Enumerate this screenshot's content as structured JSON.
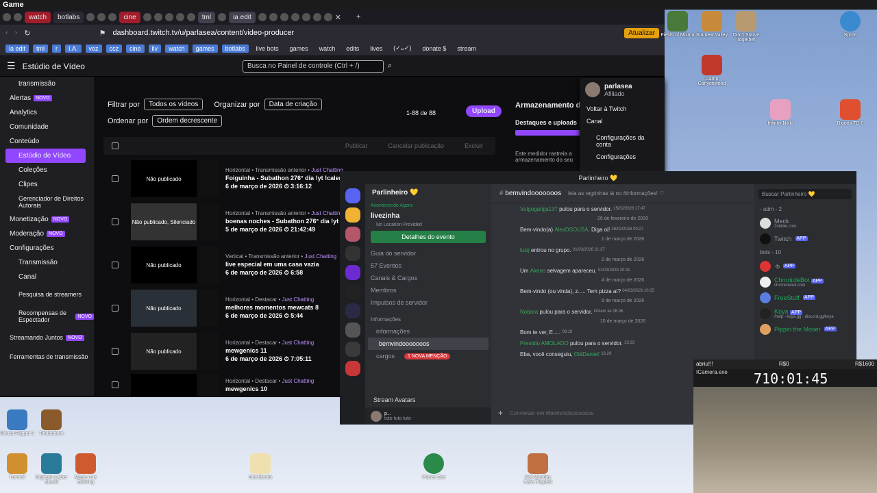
{
  "game_title": "Game",
  "browser": {
    "tabs": [
      "watch",
      "botlabs",
      "cine",
      "tml",
      "ia edit"
    ],
    "url": "dashboard.twitch.tv/u/parlasea/content/video-producer",
    "update_label": "Atualizar",
    "bookmarks": [
      "ia edit",
      "tml",
      "r",
      "I.A.",
      "voz",
      "ccz",
      "cine",
      "liv",
      "watch",
      "games",
      "botlabs",
      "live bots",
      "games",
      "watch",
      "edits",
      "lives",
      "(✓ᴗ✓)",
      "donate $",
      "stream"
    ]
  },
  "twitch": {
    "studio_title": "Estúdio de Vídeo",
    "search_placeholder": "Busca no Painel de controle (Ctrl + /)",
    "sidebar": [
      "transmissão",
      "Alertas",
      "Analytics",
      "Comunidade",
      "Conteúdo",
      "Estúdio de Vídeo",
      "Coleções",
      "Clipes",
      "Gerenciador de Direitos Autorais",
      "Monetização",
      "Moderação",
      "Configurações",
      "Transmissão",
      "Canal",
      "Pesquisa de streamers",
      "Recompensas de Espectador",
      "Streamando Juntos",
      "Ferramentas de transmissão"
    ],
    "new_badge": "NOVO",
    "filter_label": "Filtrar por",
    "filter_value": "Todos os vídeos",
    "organize_label": "Organizar por",
    "organize_value": "Data de criação",
    "order_label": "Ordenar por",
    "order_value": "Ordem decrescente",
    "count": "1-88 de 88",
    "upload": "Upload",
    "actions": [
      "Publicar",
      "Cancelar publicação",
      "Excluir"
    ],
    "storage_title": "Armazenamento de",
    "storage_sub": "Destaques e uploads",
    "storage_text": "Este medidor rastreia a armazenamento do seu",
    "rows": [
      {
        "meta": "Horizontal • Transmissão anterior •",
        "cat": "Just Chatting",
        "title": "Foiguinha - Subathon 276° dia !yt !calend Chatting\"",
        "date": "6 de março de 2026",
        "dur": "3:16:12",
        "status": "Não publicado"
      },
      {
        "meta": "Horizontal • Transmissão anterior •",
        "cat": "Just Chatting",
        "title": "boenas noches - Subathon 276° dia !yt !calend Chatting\"",
        "date": "5 de março de 2026",
        "dur": "21:42:49",
        "status": "Não publicado, Silenciado"
      },
      {
        "meta": "Vertical • Transmissão anterior •",
        "cat": "Just Chatting",
        "title": "live especial em uma casa vazia",
        "date": "6 de março de 2026",
        "dur": "6:58",
        "status": "Não publicado"
      },
      {
        "meta": "Horizontal • Destacar •",
        "cat": "Just Chatting",
        "title": "melhores momentos mewcats 8",
        "date": "6 de março de 2026",
        "dur": "5:44",
        "status": "Não publicado"
      },
      {
        "meta": "Horizontal • Destacar •",
        "cat": "Just Chatting",
        "title": "mewgenics 11",
        "date": "6 de março de 2026",
        "dur": "7:05:11",
        "status": "Não publicado"
      },
      {
        "meta": "Horizontal • Destacar •",
        "cat": "Just Chatting",
        "title": "mewgenics 10",
        "date": "",
        "dur": "",
        "status": ""
      }
    ],
    "dropdown": {
      "user": "parlasea",
      "role": "Afiliado",
      "items": [
        "Voltar à Twitch",
        "Canal",
        "Configurações da conta",
        "Configurações"
      ]
    }
  },
  "discord": {
    "title": "Parlinheiro 💛",
    "server": "Parlinheiro 💛",
    "event_now": "Acontecendo Agora",
    "event_name": "livezinha",
    "event_loc": "No Location Provided",
    "event_btn": "Detalhes do evento",
    "channels": [
      "Guia do servidor",
      "57 Eventos",
      "Canais & Cargos",
      "Membros",
      "Impulsos de servidor"
    ],
    "category": "Informações",
    "text_channels": [
      "informações",
      "bemvindooooooos",
      "cargos",
      "avisos"
    ],
    "mention_badge": "1 NOVA MENÇÃO",
    "stream_avatars": "Stream Avatars",
    "user": "p...",
    "user_status": "tuto tuto tuto",
    "channel": "bemvindooooooos",
    "topic": "leia as regrinhas lá no #informações! ♡",
    "search": "Buscar Parlinheiro 💛",
    "messages": [
      {
        "type": "msg",
        "user": "Vulgoganjja137",
        "text": "pulou para o servidor.",
        "time": "15/02/2026 17:47"
      },
      {
        "type": "date",
        "text": "26 de fevereiro de 2026"
      },
      {
        "type": "msg",
        "user": "AlexDSOUSA",
        "pre": "Bem-vindo(a)",
        "text": ". Diga oi!",
        "time": "26/02/2026 00:27"
      },
      {
        "type": "date",
        "text": "1 de março de 2026"
      },
      {
        "type": "msg",
        "user": "luizj",
        "text": "entrou no grupo.",
        "time": "01/03/2026 21:37"
      },
      {
        "type": "date",
        "text": "2 de março de 2026"
      },
      {
        "type": "msg",
        "user": "Akeno",
        "pre": "Um",
        "text": "selvagem apareceu.",
        "time": "02/03/2026 20:41"
      },
      {
        "type": "date",
        "text": "4 de março de 2026"
      },
      {
        "type": "msg",
        "user": "",
        "pre": "Bem-vindo (ou vinda), z..... Tem pizza aí?",
        "text": "",
        "time": "04/03/2026 10:25"
      },
      {
        "type": "date",
        "text": "9 de março de 2026"
      },
      {
        "type": "msg",
        "user": "Nobara",
        "text": "pulou para o servidor.",
        "time": "Ontem às 06:06"
      },
      {
        "type": "date",
        "text": "10 de março de 2026"
      },
      {
        "type": "msg",
        "user": "",
        "pre": "Bom te ver, E.....",
        "text": "",
        "time": "08:18"
      },
      {
        "type": "msg",
        "user": "Presidio AMOLADO",
        "text": "pulou para o servidor.",
        "time": "13:33"
      },
      {
        "type": "msg",
        "user": "OláDaniel!",
        "pre": "Eba, você conseguiu,",
        "text": "",
        "time": "16:29"
      }
    ],
    "input_placeholder": "Conversar em #bemvindooooooos",
    "member_groups": [
      {
        "label": "- adm - 2",
        "members": [
          {
            "name": "Meck",
            "sub": "2nibble.com"
          },
          {
            "name": "Twitch",
            "app": "APP"
          }
        ]
      },
      {
        "label": "bots - 10",
        "members": [
          {
            "name": "·b",
            "app": "APP"
          },
          {
            "name": "ChronicleBot",
            "sub": "chroniclebot.com",
            "app": "APP"
          },
          {
            "name": "FreeStuff",
            "app": "APP"
          },
          {
            "name": "Koya",
            "sub": "/help - koya.gg - discord.gg/koya",
            "app": "APP"
          },
          {
            "name": "Pippin the Moser",
            "app": "APP"
          }
        ]
      }
    ]
  },
  "cam": {
    "label": "abriu!!!",
    "amount": "R$0",
    "goal": "R$1600",
    "app": "ICamera.exe",
    "timer": "710:01:45"
  },
  "desktop": [
    "Fields of Mistria",
    "Stardew Valley",
    "Don't Starve Together",
    "Spore",
    "Camp Canyonwood",
    "Infinity Nikki",
    "Bloons TD 6",
    "House Flipper 2",
    "Timberborn",
    "Turmoil",
    "Digimon Cyber Sleuth",
    "Mega Cuz Gaming",
    "Stacklands",
    "Planet Zoo",
    "Not Monday Cafe Playtest"
  ]
}
